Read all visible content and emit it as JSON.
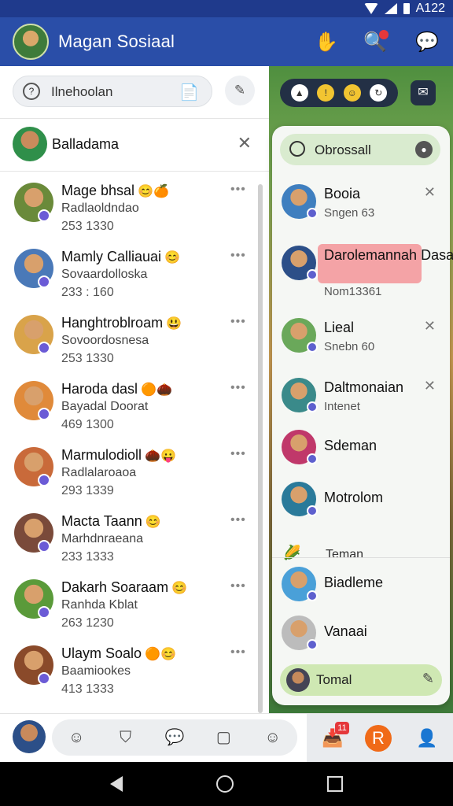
{
  "status_bar": {
    "time": "A122",
    "icons": [
      "wifi-icon",
      "signal-icon",
      "battery-icon"
    ]
  },
  "app": {
    "title": "Magan Sosiaal",
    "actions": [
      "hand-icon",
      "search-icon",
      "chat-icon"
    ]
  },
  "left_pane": {
    "search_placeholder": "Ilnehoolan",
    "pinned": {
      "name": "Balladama"
    },
    "chats": [
      {
        "name": "Mage bhsal",
        "emoji": "😊🍊",
        "preview": "Radlaoldndao",
        "time": "253 1330",
        "avatar_color": "#6a8a3a"
      },
      {
        "name": "Mamly Calliauai",
        "emoji": "😊",
        "preview": "Sovaardolloska",
        "time": "233 : 160",
        "avatar_color": "#4a79b8"
      },
      {
        "name": "Hanghtroblroam",
        "emoji": "😃",
        "preview": "Sovoordosnesa",
        "time": "253 1330",
        "avatar_color": "#d9a34a"
      },
      {
        "name": "Haroda dasl",
        "emoji": "🟠🌰",
        "preview": "Bayadal Doorat",
        "time": "469 1300",
        "avatar_color": "#e08a3a"
      },
      {
        "name": "Marmulodioll",
        "emoji": "🌰😛",
        "preview": "Radlalaroaoa",
        "time": "293 1339",
        "avatar_color": "#c96a3a"
      },
      {
        "name": "Macta Taann",
        "emoji": "😊",
        "preview": "Marhdnraeana",
        "time": "233 1333",
        "avatar_color": "#7a4a3a"
      },
      {
        "name": "Dakarh Soaraam",
        "emoji": "😊",
        "preview": "Ranhda Kblat",
        "time": "263 1230",
        "avatar_color": "#5a9a3a"
      },
      {
        "name": "Ulaym Soalo",
        "emoji": "🟠😊",
        "preview": "Baamiookes",
        "time": "413 1333",
        "avatar_color": "#8a4a2a"
      }
    ]
  },
  "right_pane": {
    "search_placeholder": "Obrossall",
    "contacts": [
      {
        "name": "Booia",
        "sub": "Sngen 63",
        "avatar_color": "#3f7fbf"
      },
      {
        "name": "Darolemannah Dasa",
        "sub": "Nom13361",
        "avatar_color": "#2c4f88",
        "highlighted": true
      },
      {
        "name": "Lieal",
        "sub": "Snebn 60",
        "avatar_color": "#6aa85a"
      },
      {
        "name": "Daltmonaian",
        "sub": "Intenet",
        "avatar_color": "#3a8a8a"
      },
      {
        "name": "Sdeman",
        "sub": "",
        "avatar_color": "#c0386a"
      },
      {
        "name": "Motrolom",
        "sub": "",
        "avatar_color": "#2a7a9a"
      },
      {
        "name": "Teman",
        "sub": "",
        "avatar_color": "#f5f7f4"
      },
      {
        "name": "Biadleme",
        "sub": "",
        "avatar_color": "#4aa0d8"
      },
      {
        "name": "Vanaai",
        "sub": "",
        "avatar_color": "#bcbcbc"
      }
    ],
    "bottom_label": "Tomal"
  },
  "toolbar": {
    "notification_count": "11",
    "orange_label": "R"
  }
}
